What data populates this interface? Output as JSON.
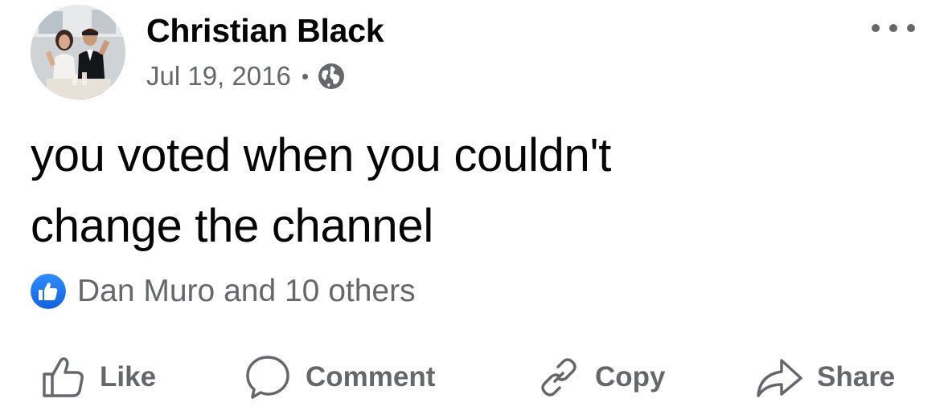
{
  "post": {
    "author": {
      "name": "Christian Black"
    },
    "meta": {
      "date": "Jul 19, 2016",
      "visibility_icon": "globe-icon"
    },
    "more_icon": "ellipsis-icon",
    "text_lines": [
      "you voted when you couldn't",
      "change the channel"
    ],
    "reactions": {
      "icon": "like-reaction-icon",
      "summary": "Dan Muro and 10 others"
    },
    "actions": {
      "like": {
        "label": "Like",
        "icon": "thumbs-up-icon"
      },
      "comment": {
        "label": "Comment",
        "icon": "speech-bubble-icon"
      },
      "copy": {
        "label": "Copy",
        "icon": "link-icon"
      },
      "share": {
        "label": "Share",
        "icon": "share-arrow-icon"
      }
    }
  },
  "colors": {
    "primary_text": "#050505",
    "secondary_text": "#65676b",
    "like_blue": "#1877f2",
    "background": "#ffffff"
  }
}
